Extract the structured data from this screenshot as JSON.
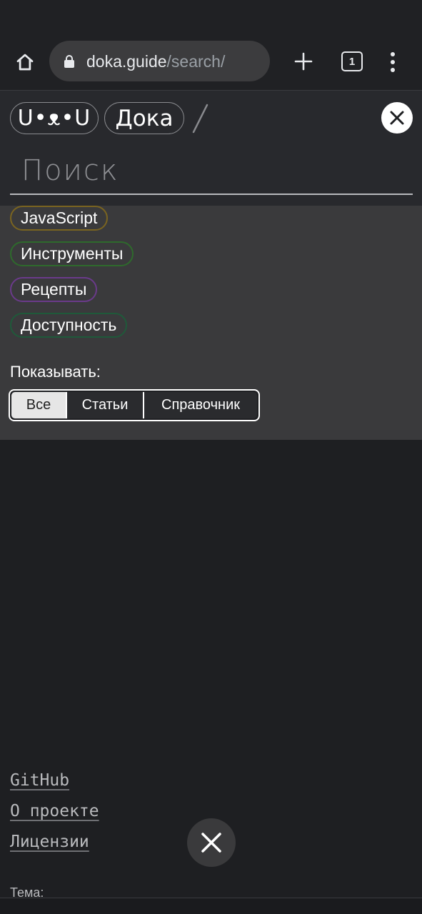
{
  "browser": {
    "url_domain": "doka.guide",
    "url_path": "/search/",
    "tab_count": "1"
  },
  "header": {
    "logo": "U•ᴥ•U",
    "site_name": "Дока",
    "search_placeholder": "Поиск"
  },
  "filters": {
    "tags": [
      "JavaScript",
      "Инструменты",
      "Рецепты",
      "Доступность"
    ],
    "tag_colors": [
      "#7a6420",
      "#2e6a2c",
      "#6a3a8a",
      "#1f5a3a"
    ],
    "show_label": "Показывать:",
    "segments": [
      "Все",
      "Статьи",
      "Справочник"
    ],
    "active_segment": "Все"
  },
  "footer": {
    "links": [
      "GitHub",
      "О проекте",
      "Лицензии"
    ],
    "theme_label": "Тема:"
  },
  "icons": {
    "home": "home-icon",
    "lock": "lock-icon",
    "plus": "plus-icon",
    "tabs": "tabs-icon",
    "menu": "more-vert-icon",
    "close": "close-icon",
    "slash": "slash-icon"
  }
}
